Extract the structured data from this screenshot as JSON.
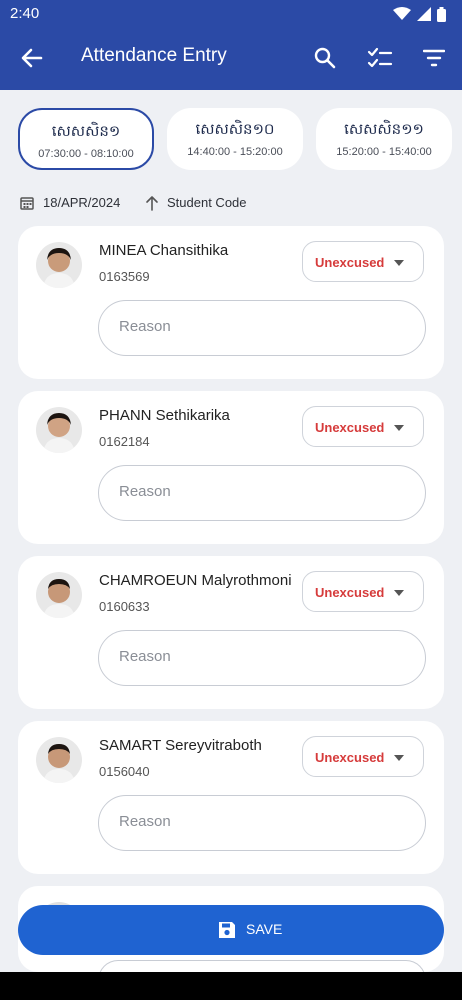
{
  "status_bar": {
    "time": "2:40"
  },
  "app_bar": {
    "title": "Attendance Entry"
  },
  "sessions": [
    {
      "name": "សេសសិន១",
      "time": "07:30:00 - 08:10:00",
      "selected": true
    },
    {
      "name": "សេសសិន១០",
      "time": "14:40:00 - 15:20:00",
      "selected": false
    },
    {
      "name": "សេសសិន១១",
      "time": "15:20:00 - 15:40:00",
      "selected": false
    }
  ],
  "filter": {
    "date": "18/APR/2024",
    "sort_label": "Student Code"
  },
  "students": [
    {
      "name": "MINEA Chansithika",
      "code": "0163569",
      "status": "Unexcused",
      "reason_placeholder": "Reason"
    },
    {
      "name": "PHANN Sethikarika",
      "code": "0162184",
      "status": "Unexcused",
      "reason_placeholder": "Reason"
    },
    {
      "name": "CHAMROEUN Malyrothmoni",
      "code": "0160633",
      "status": "Unexcused",
      "reason_placeholder": "Reason"
    },
    {
      "name": "SAMART Sereyvitraboth",
      "code": "0156040",
      "status": "Unexcused",
      "reason_placeholder": "Reason"
    }
  ],
  "save_button": {
    "label": "SAVE"
  },
  "colors": {
    "primary": "#2b4aa6",
    "save": "#1f63d1",
    "unexcused": "#d63b3b"
  },
  "icons": [
    "back-arrow-icon",
    "search-icon",
    "checklist-icon",
    "filter-icon",
    "calendar-icon",
    "sort-arrow-up-icon",
    "save-disk-icon",
    "wifi-icon",
    "signal-icon",
    "battery-icon"
  ]
}
